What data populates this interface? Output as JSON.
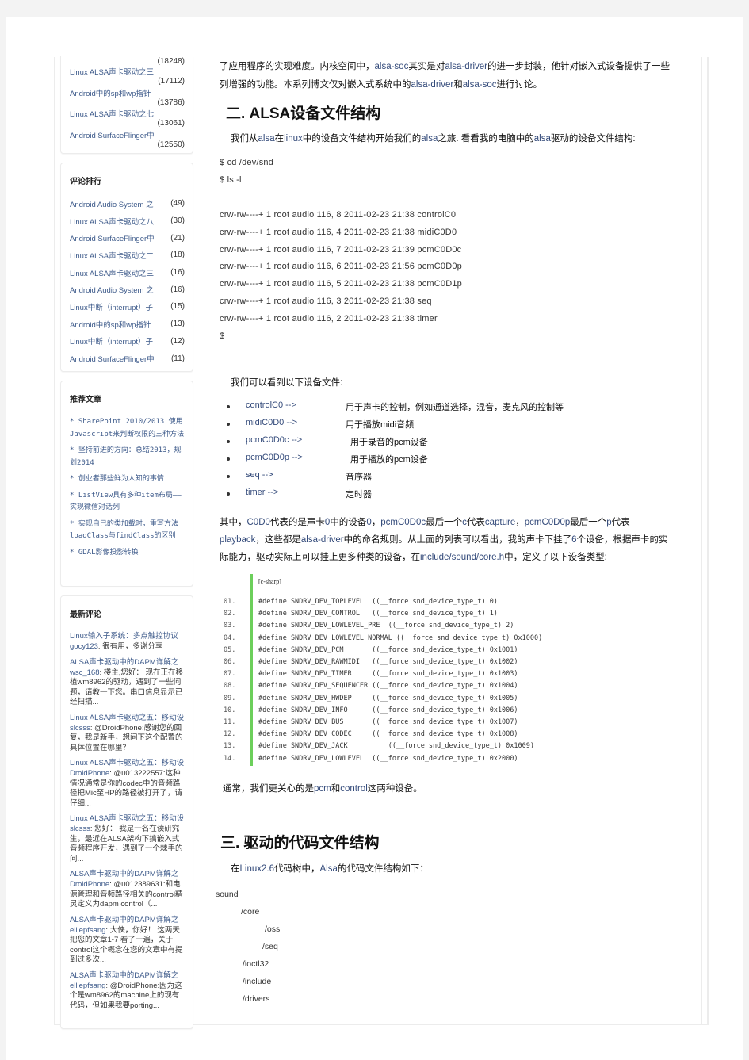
{
  "sidebar": {
    "reads": {
      "first_count": "(18248)",
      "items": [
        {
          "title": "Linux ALSA声卡驱动之三",
          "count": "(17112)"
        },
        {
          "title": "Android中的sp和wp指针",
          "count": "(13786)"
        },
        {
          "title": "Linux ALSA声卡驱动之七",
          "count": "(13061)"
        },
        {
          "title": "Android SurfaceFlinger中",
          "count": "(12550)"
        }
      ]
    },
    "comment_rank": {
      "title": "评论排行",
      "items": [
        {
          "title": "Android Audio System 之",
          "count": "(49)"
        },
        {
          "title": "Linux ALSA声卡驱动之八",
          "count": "(30)"
        },
        {
          "title": "Android SurfaceFlinger中",
          "count": "(21)"
        },
        {
          "title": "Linux ALSA声卡驱动之二",
          "count": "(18)"
        },
        {
          "title": "Linux ALSA声卡驱动之三",
          "count": "(16)"
        },
        {
          "title": "Android Audio System 之",
          "count": "(16)"
        },
        {
          "title": "Linux中断（interrupt）子",
          "count": "(15)"
        },
        {
          "title": "Android中的sp和wp指针",
          "count": "(13)"
        },
        {
          "title": "Linux中断（interrupt）子",
          "count": "(12)"
        },
        {
          "title": "Android SurfaceFlinger中",
          "count": "(11)"
        }
      ]
    },
    "recommended": {
      "title": "推荐文章",
      "items": [
        "* SharePoint 2010/2013 使用Javascript来判断权限的三种方法",
        "* 坚持前进的方向：总结2013，规划2014",
        "* 创业者那些鲜为人知的事情",
        "* ListView具有多种item布局——实现微信对话列",
        "* 实现自己的类加载时，重写方法loadClass与findClass的区别",
        "* GDAL影像投影转换"
      ]
    },
    "latest_comments": {
      "title": "最新评论",
      "items": [
        {
          "title": "Linux输入子系统：多点触控协议",
          "user": "gocy123",
          "text": ": 很有用，多谢分享"
        },
        {
          "title": "ALSA声卡驱动中的DAPM详解之",
          "user": "wsc_168",
          "text": ": 楼主,您好： 现在正在移植wm8962的驱动，遇到了一些问题，请教一下您。串口信息显示已经扫描..."
        },
        {
          "title": "Linux ALSA声卡驱动之五：移动设",
          "user": "slcsss",
          "text": ": @DroidPhone:感谢您的回复，我是新手，想问下这个配置的具体位置在哪里？"
        },
        {
          "title": "Linux ALSA声卡驱动之五：移动设",
          "user": "DroidPhone",
          "text": ": @u013222557:这种情况通常是你的codec中的音频路径把Mic至HP的路径被打开了，请仔细..."
        },
        {
          "title": "Linux ALSA声卡驱动之五：移动设",
          "user": "slcsss",
          "text": ": 您好： 我是一名在读研究生，最近在ALSA架构下搞嵌入式音频程序开发，遇到了一个棘手的问..."
        },
        {
          "title": "ALSA声卡驱动中的DAPM详解之",
          "user": "DroidPhone",
          "text": ": @u012389631:和电源管理和音频路径相关的control精灵定义为dapm control（..."
        },
        {
          "title": "ALSA声卡驱动中的DAPM详解之",
          "user": "elliepfsang",
          "text": ": 大侠，你好！ 这两天把您的文章1-7 看了一遍，关于control这个概念在您的文章中有提到过多次..."
        },
        {
          "title": "ALSA声卡驱动中的DAPM详解之",
          "user": "elliepfsang",
          "text": ": @DroidPhone:因为这个是wm8962的machine上的现有代码，但如果我要porting..."
        }
      ]
    }
  },
  "article": {
    "intro_line1": [
      {
        "t": "了应用程序的实现难度。内核空间中，",
        "en": false
      },
      {
        "t": "alsa-soc",
        "en": true
      },
      {
        "t": "其实是对",
        "en": false
      },
      {
        "t": "alsa-driver",
        "en": true
      },
      {
        "t": "的进一步封装，他针对嵌入式设备提供了一些",
        "en": false
      }
    ],
    "intro_line2": [
      {
        "t": "列增强的功能。本系列博文仅对嵌入式系统中的",
        "en": false
      },
      {
        "t": "alsa-driver",
        "en": true
      },
      {
        "t": "和",
        "en": false
      },
      {
        "t": "alsa-soc",
        "en": true
      },
      {
        "t": "进行讨论。",
        "en": false
      }
    ],
    "section2_title": "二.  ALSA设备文件结构",
    "section2_intro": [
      {
        "t": "我们从",
        "en": false
      },
      {
        "t": "alsa",
        "en": true
      },
      {
        "t": "在",
        "en": false
      },
      {
        "t": "linux",
        "en": true
      },
      {
        "t": "中的设备文件结构开始我们的",
        "en": false
      },
      {
        "t": "alsa",
        "en": true
      },
      {
        "t": "之旅. 看看我的电脑中的",
        "en": false
      },
      {
        "t": "alsa",
        "en": true
      },
      {
        "t": "驱动的设备文件结构:",
        "en": false
      }
    ],
    "shell_lines": [
      "$ cd /dev/snd",
      "$ ls -l",
      "",
      "crw-rw----+ 1 root audio 116, 8 2011-02-23 21:38 controlC0",
      "crw-rw----+ 1 root audio 116, 4 2011-02-23 21:38 midiC0D0",
      "crw-rw----+ 1 root audio 116, 7 2011-02-23 21:39 pcmC0D0c",
      "crw-rw----+ 1 root audio 116, 6 2011-02-23 21:56 pcmC0D0p",
      "crw-rw----+ 1 root audio 116, 5 2011-02-23 21:38 pcmC0D1p",
      "crw-rw----+ 1 root audio 116, 3 2011-02-23 21:38 seq",
      "crw-rw----+ 1 root audio 116, 2 2011-02-23 21:38 timer",
      "$"
    ],
    "devices_intro": "我们可以看到以下设备文件:",
    "devices": [
      {
        "name": "controlC0 -->",
        "desc": "用于声卡的控制，例如通道选择，混音，麦克风的控制等"
      },
      {
        "name": "midiC0D0  -->",
        "desc": "用于播放midi音频"
      },
      {
        "name": "pcmC0D0c -->",
        "desc": "用于录音的pcm设备"
      },
      {
        "name": "pcmC0D0p -->",
        "desc": "用于播放的pcm设备"
      },
      {
        "name": "seq  -->",
        "desc": "音序器"
      },
      {
        "name": "timer -->",
        "desc": "定时器"
      }
    ],
    "explain_lines": [
      [
        {
          "t": "其中，",
          "en": false
        },
        {
          "t": "C0D0",
          "en": true
        },
        {
          "t": "代表的是声卡",
          "en": false
        },
        {
          "t": "0",
          "en": true
        },
        {
          "t": "中的设备",
          "en": false
        },
        {
          "t": "0",
          "en": true
        },
        {
          "t": "，",
          "en": false
        },
        {
          "t": "pcmC0D0c",
          "en": true
        },
        {
          "t": "最后一个",
          "en": false
        },
        {
          "t": "c",
          "en": true
        },
        {
          "t": "代表",
          "en": false
        },
        {
          "t": "capture",
          "en": true
        },
        {
          "t": "，",
          "en": false
        },
        {
          "t": "pcmC0D0p",
          "en": true
        },
        {
          "t": "最后一个",
          "en": false
        },
        {
          "t": "p",
          "en": true
        },
        {
          "t": "代表",
          "en": false
        }
      ],
      [
        {
          "t": "playback",
          "en": true
        },
        {
          "t": "，这些都是",
          "en": false
        },
        {
          "t": "alsa-driver",
          "en": true
        },
        {
          "t": "中的命名规则。从上面的列表可以看出，我的声卡下挂了",
          "en": false
        },
        {
          "t": "6",
          "en": true
        },
        {
          "t": "个设备，根据声卡的实",
          "en": false
        }
      ],
      [
        {
          "t": "际能力，驱动实际上可以挂上更多种类的设备，在",
          "en": false
        },
        {
          "t": "include/sound/core.h",
          "en": true
        },
        {
          "t": "中，定义了以下设备类型:",
          "en": false
        }
      ]
    ],
    "code": {
      "lang": "[c-sharp]",
      "lines": [
        {
          "n": "01.",
          "s": "#define SNDRV_DEV_TOPLEVEL  ((__force snd_device_type_t) 0)"
        },
        {
          "n": "02.",
          "s": "#define SNDRV_DEV_CONTROL   ((__force snd_device_type_t) 1)"
        },
        {
          "n": "03.",
          "s": "#define SNDRV_DEV_LOWLEVEL_PRE  ((__force snd_device_type_t) 2)"
        },
        {
          "n": "04.",
          "s": "#define SNDRV_DEV_LOWLEVEL_NORMAL ((__force snd_device_type_t) 0x1000)"
        },
        {
          "n": "05.",
          "s": "#define SNDRV_DEV_PCM       ((__force snd_device_type_t) 0x1001)"
        },
        {
          "n": "06.",
          "s": "#define SNDRV_DEV_RAWMIDI   ((__force snd_device_type_t) 0x1002)"
        },
        {
          "n": "07.",
          "s": "#define SNDRV_DEV_TIMER     ((__force snd_device_type_t) 0x1003)"
        },
        {
          "n": "08.",
          "s": "#define SNDRV_DEV_SEQUENCER ((__force snd_device_type_t) 0x1004)"
        },
        {
          "n": "09.",
          "s": "#define SNDRV_DEV_HWDEP     ((__force snd_device_type_t) 0x1005)"
        },
        {
          "n": "10.",
          "s": "#define SNDRV_DEV_INFO      ((__force snd_device_type_t) 0x1006)"
        },
        {
          "n": "11.",
          "s": "#define SNDRV_DEV_BUS       ((__force snd_device_type_t) 0x1007)"
        },
        {
          "n": "12.",
          "s": "#define SNDRV_DEV_CODEC     ((__force snd_device_type_t) 0x1008)"
        },
        {
          "n": "13.",
          "s": "#define SNDRV_DEV_JACK          ((__force snd_device_type_t) 0x1009)"
        },
        {
          "n": "14.",
          "s": "#define SNDRV_DEV_LOWLEVEL  ((__force snd_device_type_t) 0x2000)"
        }
      ]
    },
    "summary": [
      {
        "t": "通常，我们更关心的是",
        "en": false
      },
      {
        "t": "pcm",
        "en": true
      },
      {
        "t": "和",
        "en": false
      },
      {
        "t": "control",
        "en": true
      },
      {
        "t": "这两种设备。",
        "en": false
      }
    ],
    "section3_title": "三.  驱动的代码文件结构",
    "section3_intro": [
      {
        "t": "在",
        "en": false
      },
      {
        "t": "Linux2.6",
        "en": true
      },
      {
        "t": "代码树中，",
        "en": false
      },
      {
        "t": "Alsa",
        "en": true
      },
      {
        "t": "的代码文件结构如下：",
        "en": false
      }
    ],
    "tree": [
      "sound",
      "/core",
      "/oss",
      "/seq",
      "/ioctl32",
      "/include",
      "/drivers"
    ]
  }
}
